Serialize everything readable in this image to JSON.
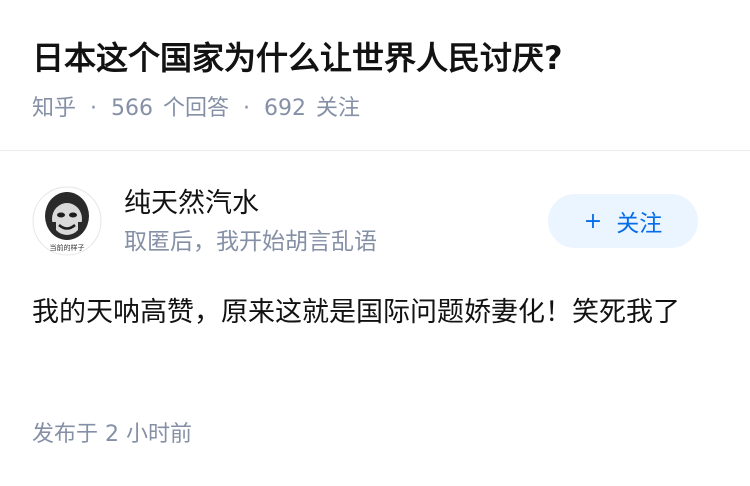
{
  "question": {
    "title": "日本这个国家为什么让世界人民讨厌?",
    "source": "知乎",
    "answer_count": "566",
    "answer_label": "个回答",
    "follower_count": "692",
    "follower_label": "关注"
  },
  "answer": {
    "author": {
      "name": "纯天然汽水",
      "bio": "取匿后，我开始胡言乱语",
      "avatar_caption": "当前的样子"
    },
    "follow_button": {
      "icon": "+",
      "label": "关注"
    },
    "content": "我的天呐高赞，原来这就是国际问题娇妻化！笑死我了",
    "published": "发布于 2 小时前"
  },
  "colors": {
    "meta_gray": "#8590a6",
    "follow_bg": "#ebf5ff",
    "follow_text": "#056de8"
  }
}
